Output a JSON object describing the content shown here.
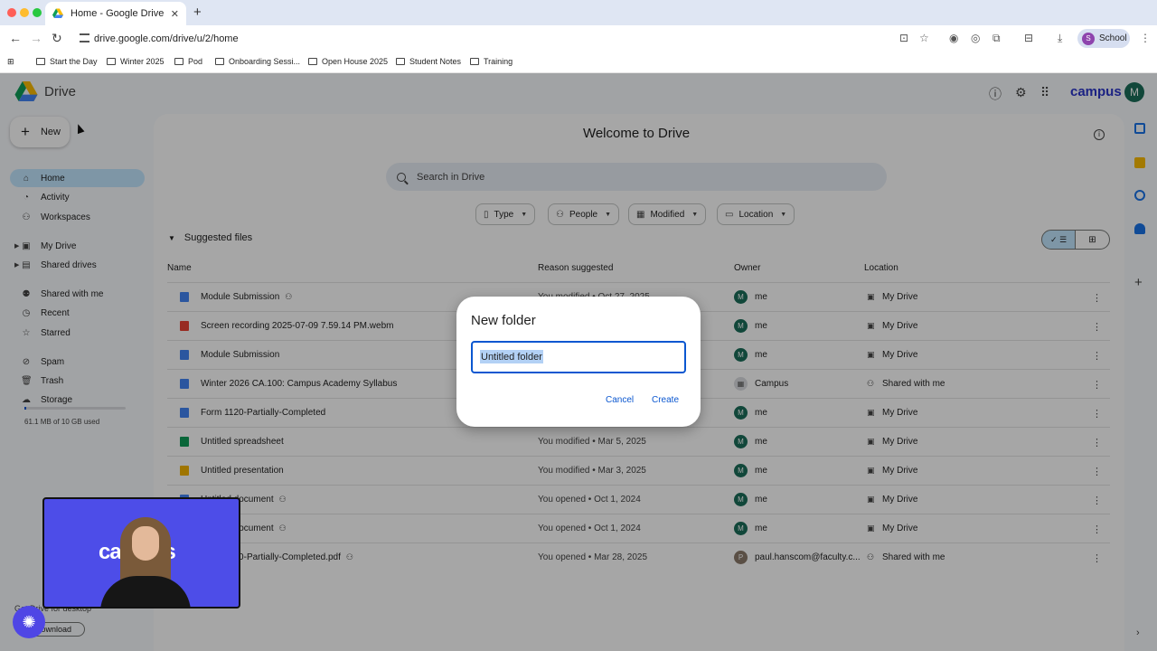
{
  "browser": {
    "tab_title": "Home - Google Drive",
    "new_tab": "+",
    "url": "drive.google.com/drive/u/2/home",
    "profile_initial": "S",
    "profile_label": "School",
    "bookmarks": [
      "Start the Day",
      "Winter 2025",
      "Pod",
      "Onboarding Sessi...",
      "Open House 2025",
      "Student Notes",
      "Training"
    ]
  },
  "drive": {
    "logo_text": "Drive",
    "campus_logo": "campus",
    "user_initial": "M",
    "new_label": "New",
    "nav": [
      {
        "label": "Home",
        "icon": "home-icon",
        "glyph": "⌂"
      },
      {
        "label": "Activity",
        "icon": "bell-icon",
        "glyph": "◔"
      },
      {
        "label": "Workspaces",
        "icon": "workspaces-icon",
        "glyph": "⚇"
      },
      {
        "label": "My Drive",
        "icon": "my-drive-icon",
        "glyph": "▣"
      },
      {
        "label": "Shared drives",
        "icon": "shared-drives-icon",
        "glyph": "▤"
      },
      {
        "label": "Shared with me",
        "icon": "people-icon",
        "glyph": "⚉"
      },
      {
        "label": "Recent",
        "icon": "clock-icon",
        "glyph": "◷"
      },
      {
        "label": "Starred",
        "icon": "star-icon",
        "glyph": "☆"
      },
      {
        "label": "Spam",
        "icon": "spam-icon",
        "glyph": "⊘"
      },
      {
        "label": "Trash",
        "icon": "trash-icon",
        "glyph": "🗑"
      },
      {
        "label": "Storage",
        "icon": "cloud-icon",
        "glyph": "☁"
      }
    ],
    "storage_used_fraction": 0.006,
    "storage_text": "61.1 MB of 10 GB used",
    "desktop_promo": "Get Drive for desktop",
    "download_label": "Download",
    "welcome": "Welcome to Drive",
    "search_placeholder": "Search in Drive",
    "filters": [
      "Type",
      "People",
      "Modified",
      "Location"
    ],
    "suggested_label": "Suggested files",
    "columns": [
      "Name",
      "Reason suggested",
      "Owner",
      "Location"
    ],
    "files": [
      {
        "name": "Module Submission",
        "shared": true,
        "type": "doc",
        "reason": "You modified • Oct 27, 2025",
        "owner": "me",
        "location": "My Drive"
      },
      {
        "name": "Screen recording 2025-07-09 7.59.14 PM.webm",
        "shared": false,
        "type": "video",
        "reason": "",
        "owner": "me",
        "location": "My Drive"
      },
      {
        "name": "Module Submission",
        "shared": false,
        "type": "doc",
        "reason": "",
        "owner": "me",
        "location": "My Drive"
      },
      {
        "name": "Winter 2026 CA.100: Campus Academy Syllabus",
        "shared": false,
        "type": "doc",
        "reason": "",
        "owner": "Campus",
        "location": "Shared with me"
      },
      {
        "name": "Form 1120-Partially-Completed",
        "shared": false,
        "type": "doc",
        "reason": "",
        "owner": "me",
        "location": "My Drive"
      },
      {
        "name": "Untitled spreadsheet",
        "shared": false,
        "type": "sheet",
        "reason": "You modified • Mar 5, 2025",
        "owner": "me",
        "location": "My Drive"
      },
      {
        "name": "Untitled presentation",
        "shared": false,
        "type": "slides",
        "reason": "You modified • Mar 3, 2025",
        "owner": "me",
        "location": "My Drive"
      },
      {
        "name": "Untitled document",
        "shared": true,
        "type": "doc",
        "reason": "You opened • Oct 1, 2024",
        "owner": "me",
        "location": "My Drive"
      },
      {
        "name": "Untitled document",
        "shared": true,
        "type": "doc",
        "reason": "You opened • Oct 1, 2024",
        "owner": "me",
        "location": "My Drive"
      },
      {
        "name": "Form 1120-Partially-Completed.pdf",
        "shared": true,
        "type": "pdf",
        "reason": "You opened • Mar 28, 2025",
        "owner": "paul.hanscom@faculty.c...",
        "location": "Shared with me"
      }
    ]
  },
  "dialog": {
    "title": "New folder",
    "value": "Untitled folder",
    "cancel": "Cancel",
    "create": "Create"
  },
  "webcam": {
    "overlay_text": "campus"
  },
  "colors": {
    "accent": "#0b57d0",
    "active_nav": "#c2e7ff",
    "campus_brand": "#2a35c9",
    "webcam_bg": "#4d4de8"
  }
}
